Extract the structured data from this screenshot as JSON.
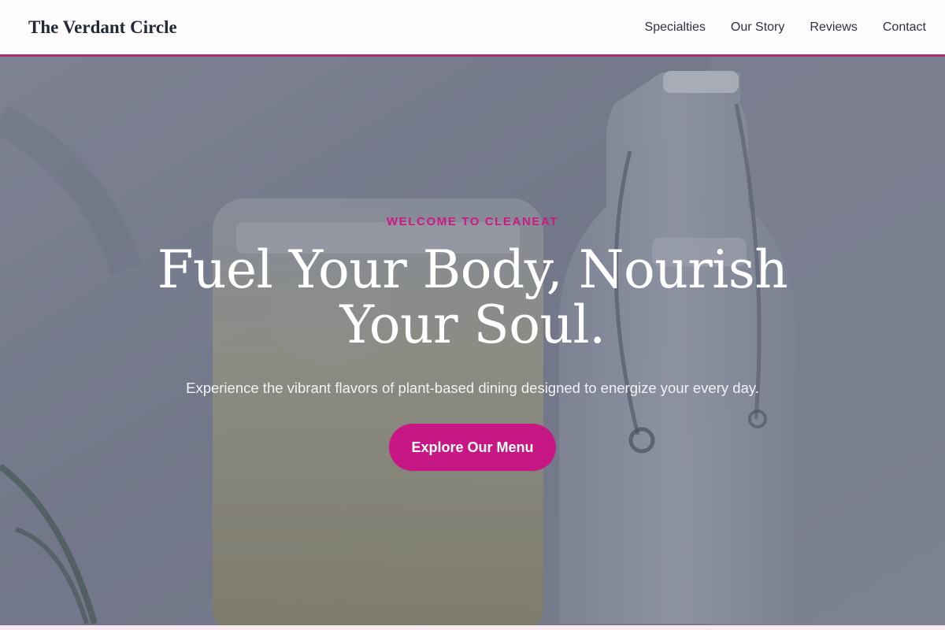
{
  "header": {
    "brand": "The Verdant Circle",
    "nav": [
      {
        "label": "Specialties"
      },
      {
        "label": "Our Story"
      },
      {
        "label": "Reviews"
      },
      {
        "label": "Contact"
      }
    ]
  },
  "hero": {
    "eyebrow": "WELCOME TO CLEANEAT",
    "headline": "Fuel Your Body, Nourish Your Soul.",
    "subtext": "Experience the vibrant flavors of plant-based dining designed to energize your every day.",
    "cta_label": "Explore Our Menu"
  },
  "colors": {
    "accent": "#c71784",
    "eyebrow": "#cc1a83",
    "nav_underline": "#a9306f"
  }
}
